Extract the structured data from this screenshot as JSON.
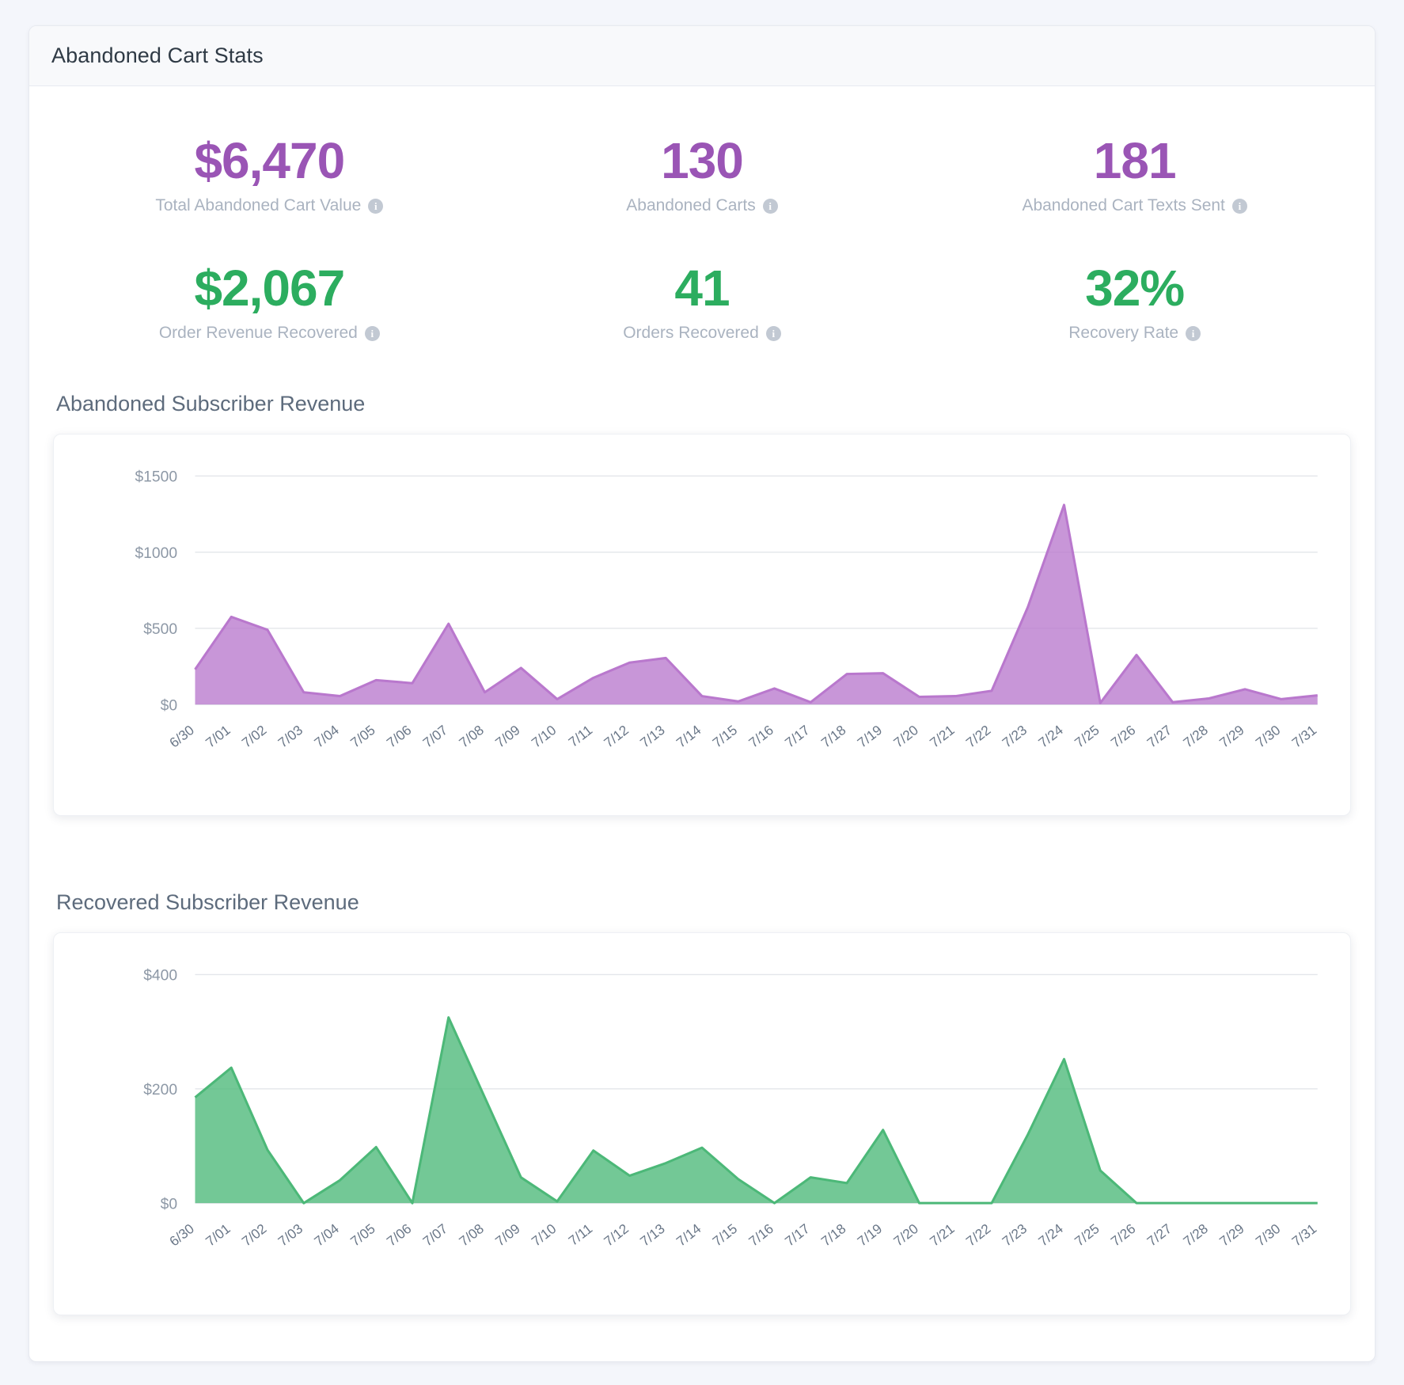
{
  "card": {
    "title": "Abandoned Cart Stats"
  },
  "stats": [
    {
      "value": "$6,470",
      "label": "Total Abandoned Cart Value",
      "color": "purple",
      "info": "i"
    },
    {
      "value": "130",
      "label": "Abandoned Carts",
      "color": "purple",
      "info": "i"
    },
    {
      "value": "181",
      "label": "Abandoned Cart Texts Sent",
      "color": "purple",
      "info": "i"
    },
    {
      "value": "$2,067",
      "label": "Order Revenue Recovered",
      "color": "green",
      "info": "i"
    },
    {
      "value": "41",
      "label": "Orders Recovered",
      "color": "green",
      "info": "i"
    },
    {
      "value": "32%",
      "label": "Recovery Rate",
      "color": "green",
      "info": "i"
    }
  ],
  "colors": {
    "purple": "#9a55b5",
    "purple_fill": "#b978cd",
    "green": "#2cad5f",
    "green_fill": "#4cb878",
    "grid": "#e3e6ea",
    "label": "#aab3c0"
  },
  "charts": [
    {
      "heading": "Abandoned Subscriber Revenue"
    },
    {
      "heading": "Recovered Subscriber Revenue"
    }
  ],
  "chart_data": [
    {
      "type": "area",
      "title": "Abandoned Subscriber Revenue",
      "xlabel": "",
      "ylabel": "",
      "ylim": [
        0,
        1500
      ],
      "grid": true,
      "legend": "none",
      "color": "#b978cd",
      "ytick_labels": [
        "$1500",
        "$1000",
        "$500",
        "$0"
      ],
      "yticks": [
        1500,
        1000,
        500,
        0
      ],
      "categories": [
        "6/30",
        "7/01",
        "7/02",
        "7/03",
        "7/04",
        "7/05",
        "7/06",
        "7/07",
        "7/08",
        "7/09",
        "7/10",
        "7/11",
        "7/12",
        "7/13",
        "7/14",
        "7/15",
        "7/16",
        "7/17",
        "7/18",
        "7/19",
        "7/20",
        "7/21",
        "7/22",
        "7/23",
        "7/24",
        "7/25",
        "7/26",
        "7/27",
        "7/28",
        "7/29",
        "7/30",
        "7/31"
      ],
      "values": [
        230,
        575,
        490,
        80,
        55,
        160,
        140,
        530,
        80,
        240,
        35,
        175,
        275,
        305,
        55,
        20,
        105,
        15,
        200,
        205,
        50,
        55,
        90,
        640,
        1310,
        10,
        325,
        15,
        40,
        100,
        35,
        60
      ]
    },
    {
      "type": "area",
      "title": "Recovered Subscriber Revenue",
      "xlabel": "",
      "ylabel": "",
      "ylim": [
        0,
        400
      ],
      "grid": true,
      "legend": "none",
      "color": "#4cb878",
      "ytick_labels": [
        "$400",
        "$200",
        "$0"
      ],
      "yticks": [
        400,
        200,
        0
      ],
      "categories": [
        "6/30",
        "7/01",
        "7/02",
        "7/03",
        "7/04",
        "7/05",
        "7/06",
        "7/07",
        "7/08",
        "7/09",
        "7/10",
        "7/11",
        "7/12",
        "7/13",
        "7/14",
        "7/15",
        "7/16",
        "7/17",
        "7/18",
        "7/19",
        "7/20",
        "7/21",
        "7/22",
        "7/23",
        "7/24",
        "7/25",
        "7/26",
        "7/27",
        "7/28",
        "7/29",
        "7/30",
        "7/31"
      ],
      "values": [
        185,
        237,
        93,
        0,
        40,
        98,
        0,
        325,
        185,
        45,
        3,
        92,
        48,
        70,
        97,
        42,
        0,
        45,
        35,
        128,
        0,
        0,
        0,
        120,
        252,
        57,
        0,
        0,
        0,
        0,
        0,
        0
      ]
    }
  ]
}
